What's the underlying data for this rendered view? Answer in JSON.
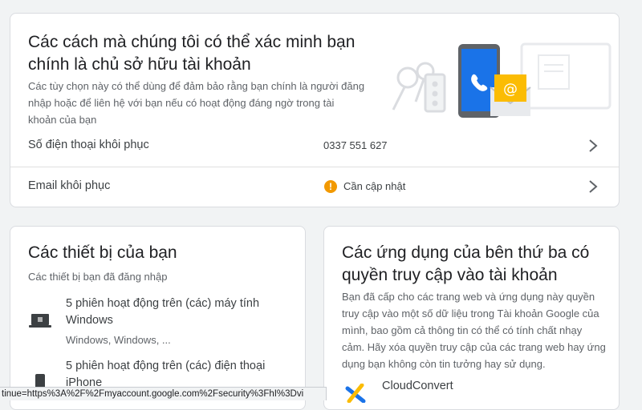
{
  "verify_card": {
    "title": "Các cách mà chúng tôi có thể xác minh bạn chính là chủ sở hữu tài khoản",
    "description": "Các tùy chọn này có thể dùng để đảm bảo rằng bạn chính là người đăng nhập hoặc để liên hệ với bạn nếu có hoạt động đáng ngờ trong tài khoản của bạn",
    "rows": [
      {
        "label": "Số điện thoại khôi phục",
        "value": "0337 551 627"
      },
      {
        "label": "Email khôi phục",
        "value": "Cần cập nhật",
        "status_icon": "warning-icon"
      }
    ]
  },
  "devices_card": {
    "title": "Các thiết bị của bạn",
    "subtitle": "Các thiết bị bạn đã đăng nhập",
    "devices": [
      {
        "title": "5 phiên hoạt động trên (các) máy tính Windows",
        "detail": "Windows, Windows, ...",
        "icon": "laptop-icon"
      },
      {
        "title": "5 phiên hoạt động trên (các) điện thoại iPhone",
        "icon": "phone-icon"
      }
    ]
  },
  "apps_card": {
    "title": "Các ứng dụng của bên thứ ba có quyền truy cập vào tài khoản",
    "description": "Bạn đã cấp cho các trang web và ứng dụng này quyền truy cập vào một số dữ liệu trong Tài khoản Google của mình, bao gồm cả thông tin có thể có tính chất nhạy cảm. Hãy xóa quyền truy cập của các trang web hay ứng dụng bạn không còn tin tưởng hay sử dụng.",
    "apps": [
      {
        "name": "CloudConvert",
        "icon": "cloudconvert-icon"
      }
    ]
  },
  "status_bar": {
    "url": "tinue=https%3A%2F%2Fmyaccount.google.com%2Fsecurity%3FhI%3Dvi"
  },
  "colors": {
    "warning": "#f29900",
    "phone_blue": "#1a73e8",
    "email_yellow": "#fbbc04"
  }
}
